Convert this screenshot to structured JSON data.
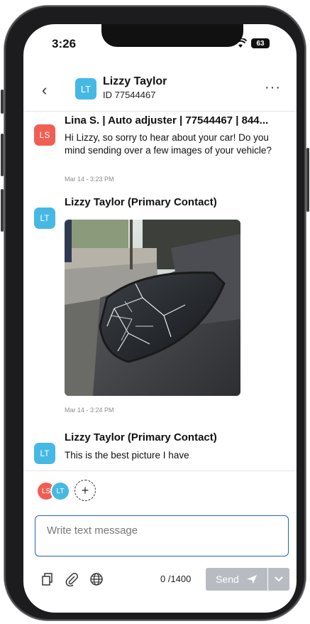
{
  "status": {
    "time": "3:26",
    "battery": "63"
  },
  "header": {
    "avatar": "LT",
    "name": "Lizzy Taylor",
    "id": "ID 77544467"
  },
  "messages": [
    {
      "avatar": "LS",
      "sender": "Lina S. | Auto adjuster | 77544467 | 844...",
      "text": "Hi Lizzy, so sorry to hear about your car! Do you mind sending over a few images of your vehicle?",
      "time": "Mar 14 - 3:23 PM"
    },
    {
      "avatar": "LT",
      "sender": "Lizzy Taylor (Primary Contact)",
      "time": "Mar 14 - 3:24 PM"
    },
    {
      "avatar": "LT",
      "sender": "Lizzy Taylor (Primary Contact)",
      "text": "This is the best picture I have"
    }
  ],
  "participants": [
    "LS",
    "LT"
  ],
  "composer": {
    "placeholder": "Write text message",
    "counter": "0 /1400",
    "send": "Send"
  },
  "colors": {
    "ls": "#ef5f55",
    "lt": "#45b9e3",
    "focus": "#2563b8",
    "send_disabled": "#b8bcc2"
  }
}
